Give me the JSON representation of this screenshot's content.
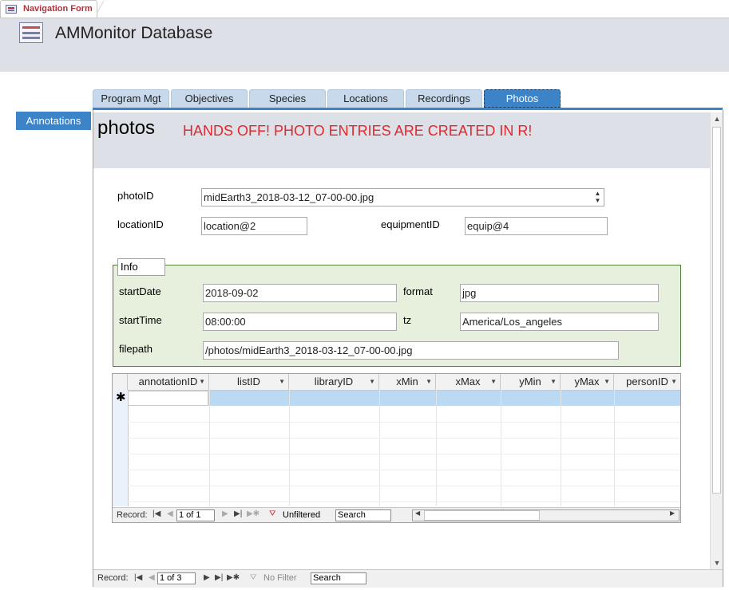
{
  "doc_tab": {
    "label": "Navigation Form"
  },
  "header": {
    "title": "AMMonitor Database"
  },
  "nav_tabs": [
    {
      "label": "Program Mgt"
    },
    {
      "label": "Objectives"
    },
    {
      "label": "Species"
    },
    {
      "label": "Locations"
    },
    {
      "label": "Recordings"
    },
    {
      "label": "Photos",
      "active": true
    }
  ],
  "side_nav": {
    "annotations_label": "Annotations"
  },
  "form": {
    "heading": "photos",
    "warning": "HANDS OFF!  PHOTO ENTRIES ARE CREATED IN R!",
    "photoID_label": "photoID",
    "photoID_value": "midEarth3_2018-03-12_07-00-00.jpg",
    "locationID_label": "locationID",
    "locationID_value": "location@2",
    "equipmentID_label": "equipmentID",
    "equipmentID_value": "equip@4",
    "info": {
      "legend": "Info",
      "startDate_label": "startDate",
      "startDate_value": "2018-09-02",
      "format_label": "format",
      "format_value": "jpg",
      "startTime_label": "startTime",
      "startTime_value": "08:00:00",
      "tz_label": "tz",
      "tz_value": "America/Los_angeles",
      "filepath_label": "filepath",
      "filepath_value": "/photos/midEarth3_2018-03-12_07-00-00.jpg"
    }
  },
  "datasheet": {
    "columns": [
      "annotationID",
      "listID",
      "libraryID",
      "xMin",
      "xMax",
      "yMin",
      "yMax",
      "personID"
    ],
    "new_row_marker": "✱",
    "nav": {
      "record_label": "Record:",
      "position": "1 of 1",
      "filter_label": "Unfiltered",
      "search_placeholder": "Search"
    }
  },
  "main_nav": {
    "record_label": "Record:",
    "position": "1 of 3",
    "filter_label": "No Filter",
    "search_placeholder": "Search"
  },
  "colors": {
    "accent": "#3c83c7",
    "warning": "#e0282e",
    "info_bg": "#e6f0dd",
    "header_bg": "#dde0e6"
  }
}
